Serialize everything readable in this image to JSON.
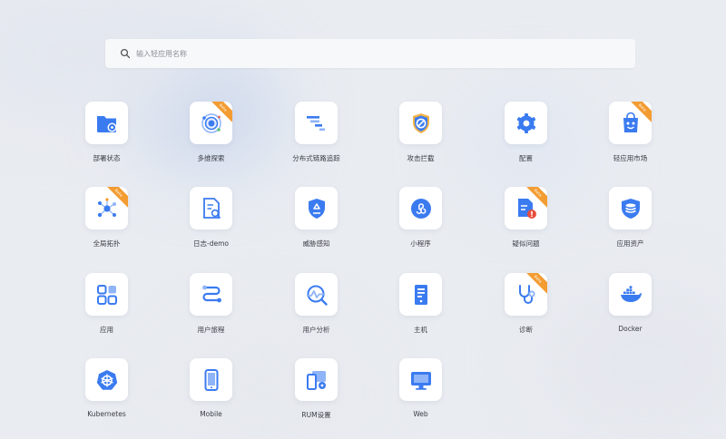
{
  "search": {
    "placeholder": "输入轻应用名称",
    "value": ""
  },
  "colors": {
    "accent": "#3b7bf0",
    "badge": "#f39c32",
    "tile": "#ffffff"
  },
  "apps": [
    {
      "label": "部署状态",
      "icon": "folder-gear-icon",
      "badge": ""
    },
    {
      "label": "多维探索",
      "icon": "orbit-icon",
      "badge": "Beta"
    },
    {
      "label": "分布式链路追踪",
      "icon": "trace-steps-icon",
      "badge": ""
    },
    {
      "label": "攻击拦截",
      "icon": "shield-ban-icon",
      "badge": ""
    },
    {
      "label": "配置",
      "icon": "gear-icon",
      "badge": ""
    },
    {
      "label": "轻应用市场",
      "icon": "shopping-bag-icon",
      "badge": "Beta"
    },
    {
      "label": "全局拓扑",
      "icon": "topology-icon",
      "badge": "Beta"
    },
    {
      "label": "日志-demo",
      "icon": "log-search-icon",
      "badge": ""
    },
    {
      "label": "威胁感知",
      "icon": "shield-recycle-icon",
      "badge": ""
    },
    {
      "label": "小程序",
      "icon": "mini-program-icon",
      "badge": ""
    },
    {
      "label": "疑似问题",
      "icon": "doc-alert-icon",
      "badge": "Beta"
    },
    {
      "label": "应用资产",
      "icon": "shield-database-icon",
      "badge": ""
    },
    {
      "label": "应用",
      "icon": "app-grid-icon",
      "badge": ""
    },
    {
      "label": "用户旅程",
      "icon": "journey-icon",
      "badge": ""
    },
    {
      "label": "用户分析",
      "icon": "analysis-icon",
      "badge": ""
    },
    {
      "label": "主机",
      "icon": "server-icon",
      "badge": ""
    },
    {
      "label": "诊断",
      "icon": "stethoscope-icon",
      "badge": "Beta"
    },
    {
      "label": "Docker",
      "icon": "docker-icon",
      "badge": ""
    },
    {
      "label": "Kubernetes",
      "icon": "kubernetes-icon",
      "badge": ""
    },
    {
      "label": "Mobile",
      "icon": "mobile-icon",
      "badge": ""
    },
    {
      "label": "RUM设置",
      "icon": "rum-settings-icon",
      "badge": ""
    },
    {
      "label": "Web",
      "icon": "web-monitor-icon",
      "badge": ""
    }
  ]
}
